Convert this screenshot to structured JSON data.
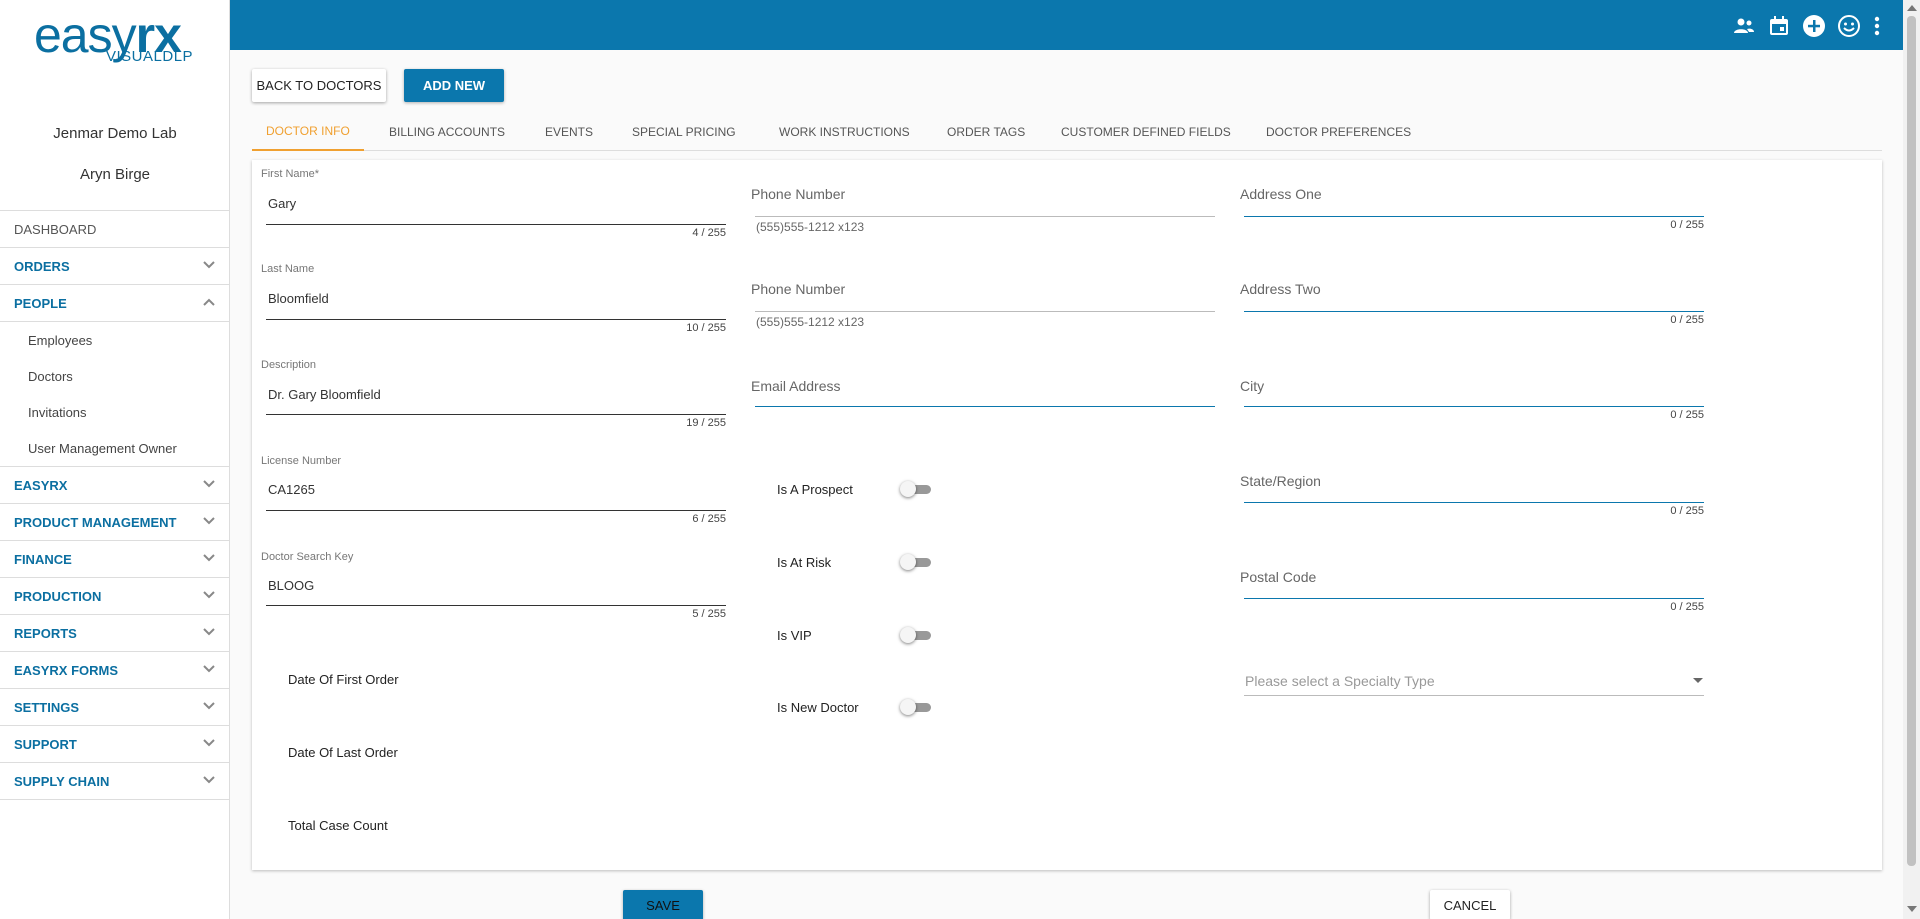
{
  "app": {
    "logo_text": "easyrx",
    "logo_sub": "VISUALDLP",
    "company": "Jenmar Demo Lab",
    "user": "Aryn Birge"
  },
  "sidebar": {
    "dashboard": "DASHBOARD",
    "items": [
      {
        "label": "ORDERS"
      },
      {
        "label": "PEOPLE"
      },
      {
        "label": "EASYRX"
      },
      {
        "label": "PRODUCT MANAGEMENT"
      },
      {
        "label": "FINANCE"
      },
      {
        "label": "PRODUCTION"
      },
      {
        "label": "REPORTS"
      },
      {
        "label": "EASYRX FORMS"
      },
      {
        "label": "SETTINGS"
      },
      {
        "label": "SUPPORT"
      },
      {
        "label": "SUPPLY CHAIN"
      }
    ],
    "people_sub": [
      "Employees",
      "Doctors",
      "Invitations",
      "User Management Owner"
    ]
  },
  "topbar": {
    "icons": [
      "people-icon",
      "calendar-icon",
      "add-circle-icon",
      "smiley-icon",
      "more-vert-icon"
    ],
    "color": "#0b77ad"
  },
  "actions": {
    "back": "BACK TO DOCTORS",
    "add_new": "ADD NEW",
    "save": "SAVE",
    "cancel": "CANCEL"
  },
  "tabs": [
    "DOCTOR INFO",
    "BILLING ACCOUNTS",
    "EVENTS",
    "SPECIAL PRICING",
    "WORK INSTRUCTIONS",
    "ORDER TAGS",
    "CUSTOMER DEFINED FIELDS",
    "DOCTOR PREFERENCES"
  ],
  "form": {
    "first_name": {
      "label": "First Name",
      "required": "*",
      "value": "Gary",
      "count": "4 / 255"
    },
    "last_name": {
      "label": "Last Name",
      "value": "Bloomfield",
      "count": "10 / 255"
    },
    "description": {
      "label": "Description",
      "value": "Dr. Gary Bloomfield",
      "count": "19 / 255"
    },
    "license": {
      "label": "License Number",
      "value": "CA1265",
      "count": "6 / 255"
    },
    "search_key": {
      "label": "Doctor Search Key",
      "value": "BLOOG",
      "count": "5 / 255"
    },
    "phone1": {
      "label": "Phone Number",
      "placeholder": "(555)555-1212 x123"
    },
    "phone2": {
      "label": "Phone Number",
      "placeholder": "(555)555-1212 x123"
    },
    "email": {
      "label": "Email Address"
    },
    "address1": {
      "label": "Address One",
      "count": "0 / 255"
    },
    "address2": {
      "label": "Address Two",
      "count": "0 / 255"
    },
    "city": {
      "label": "City",
      "count": "0 / 255"
    },
    "state": {
      "label": "State/Region",
      "count": "0 / 255"
    },
    "postal": {
      "label": "Postal Code",
      "count": "0 / 255"
    },
    "specialty": {
      "placeholder": "Please select a Specialty Type"
    },
    "toggles": [
      {
        "label": "Is A Prospect",
        "on": false
      },
      {
        "label": "Is At Risk",
        "on": false
      },
      {
        "label": "Is VIP",
        "on": false
      },
      {
        "label": "Is New Doctor",
        "on": false
      }
    ],
    "first_order": "Date Of First Order",
    "last_order": "Date Of Last Order",
    "case_count": "Total Case Count"
  }
}
